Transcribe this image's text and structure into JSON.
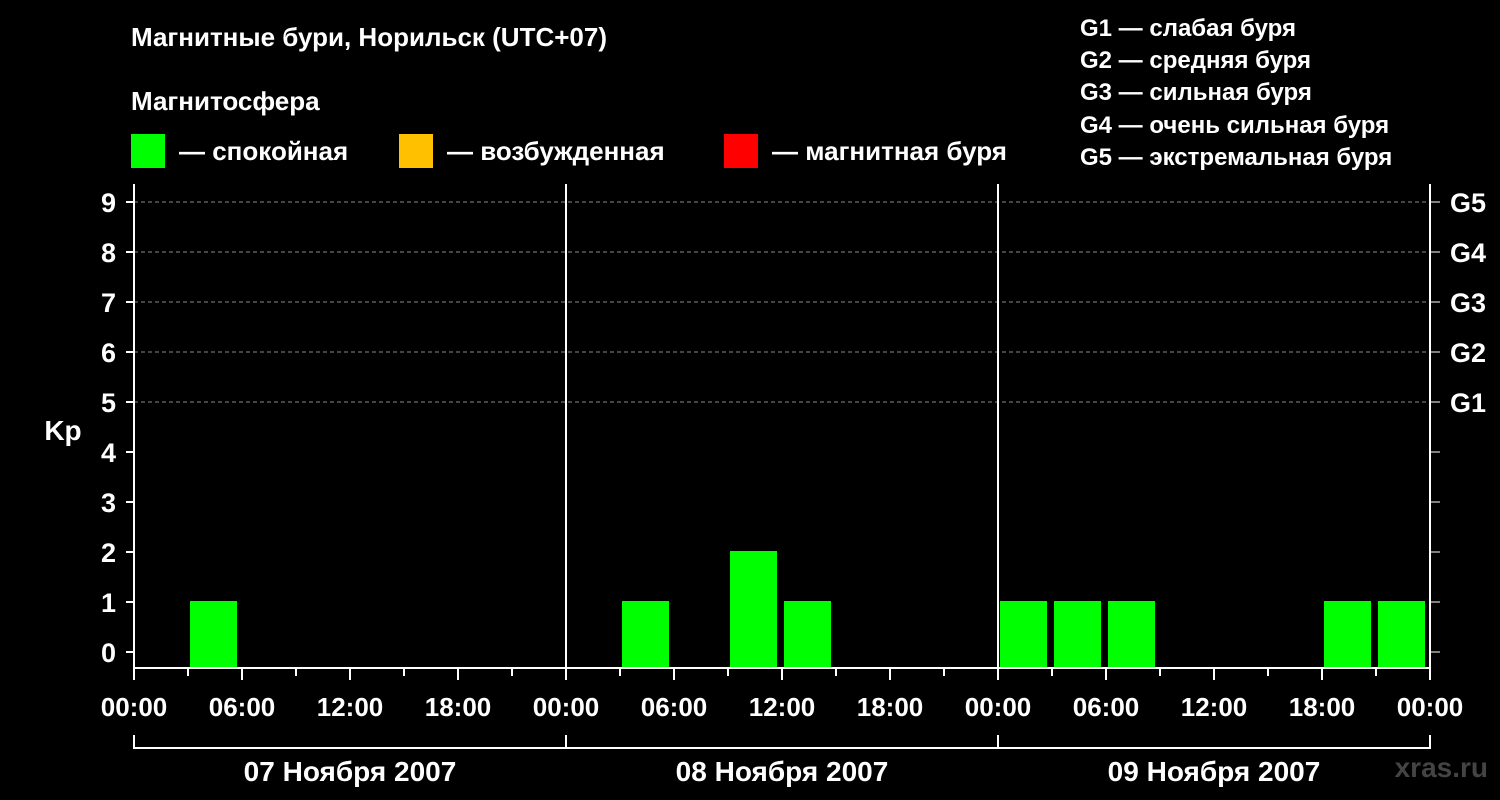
{
  "title": "Магнитные бури, Норильск (UTC+07)",
  "magnetosphere_title": "Магнитосфера",
  "legend": [
    {
      "label": "— спокойная",
      "color": "#00ff00"
    },
    {
      "label": "— возбужденная",
      "color": "#ffc000"
    },
    {
      "label": "— магнитная буря",
      "color": "#ff0000"
    }
  ],
  "g_legend": [
    "G1 — слабая буря",
    "G2 — средняя буря",
    "G3 — сильная буря",
    "G4 — очень сильная буря",
    "G5 — экстремальная буря"
  ],
  "watermark": "xras.ru",
  "chart_data": {
    "type": "bar",
    "ylabel": "Kp",
    "ylim": [
      0,
      9
    ],
    "yticks": [
      "0",
      "1",
      "2",
      "3",
      "4",
      "5",
      "6",
      "7",
      "8",
      "9"
    ],
    "right_ticks": [
      {
        "kp": 5,
        "label": "G1"
      },
      {
        "kp": 6,
        "label": "G2"
      },
      {
        "kp": 7,
        "label": "G3"
      },
      {
        "kp": 8,
        "label": "G4"
      },
      {
        "kp": 9,
        "label": "G5"
      }
    ],
    "xticks": [
      "00:00",
      "06:00",
      "12:00",
      "18:00",
      "00:00",
      "06:00",
      "12:00",
      "18:00",
      "00:00",
      "06:00",
      "12:00",
      "18:00",
      "00:00"
    ],
    "days": [
      "07 Ноября 2007",
      "08 Ноября 2007",
      "09 Ноября 2007"
    ],
    "bar_color": "#00ff00",
    "grid": "dashed horizontal lines at Kp 5–9",
    "bars": [
      {
        "time": "07 Nov 03:00–06:00",
        "kp": 1
      },
      {
        "time": "08 Nov 03:00–06:00",
        "kp": 1
      },
      {
        "time": "08 Nov 09:00–12:00",
        "kp": 2
      },
      {
        "time": "08 Nov 12:00–15:00",
        "kp": 1
      },
      {
        "time": "09 Nov 00:00–03:00",
        "kp": 1
      },
      {
        "time": "09 Nov 03:00–06:00",
        "kp": 1
      },
      {
        "time": "09 Nov 06:00–09:00",
        "kp": 1
      },
      {
        "time": "09 Nov 18:00–21:00",
        "kp": 1
      },
      {
        "time": "09 Nov 21:00–24:00",
        "kp": 1
      }
    ]
  }
}
